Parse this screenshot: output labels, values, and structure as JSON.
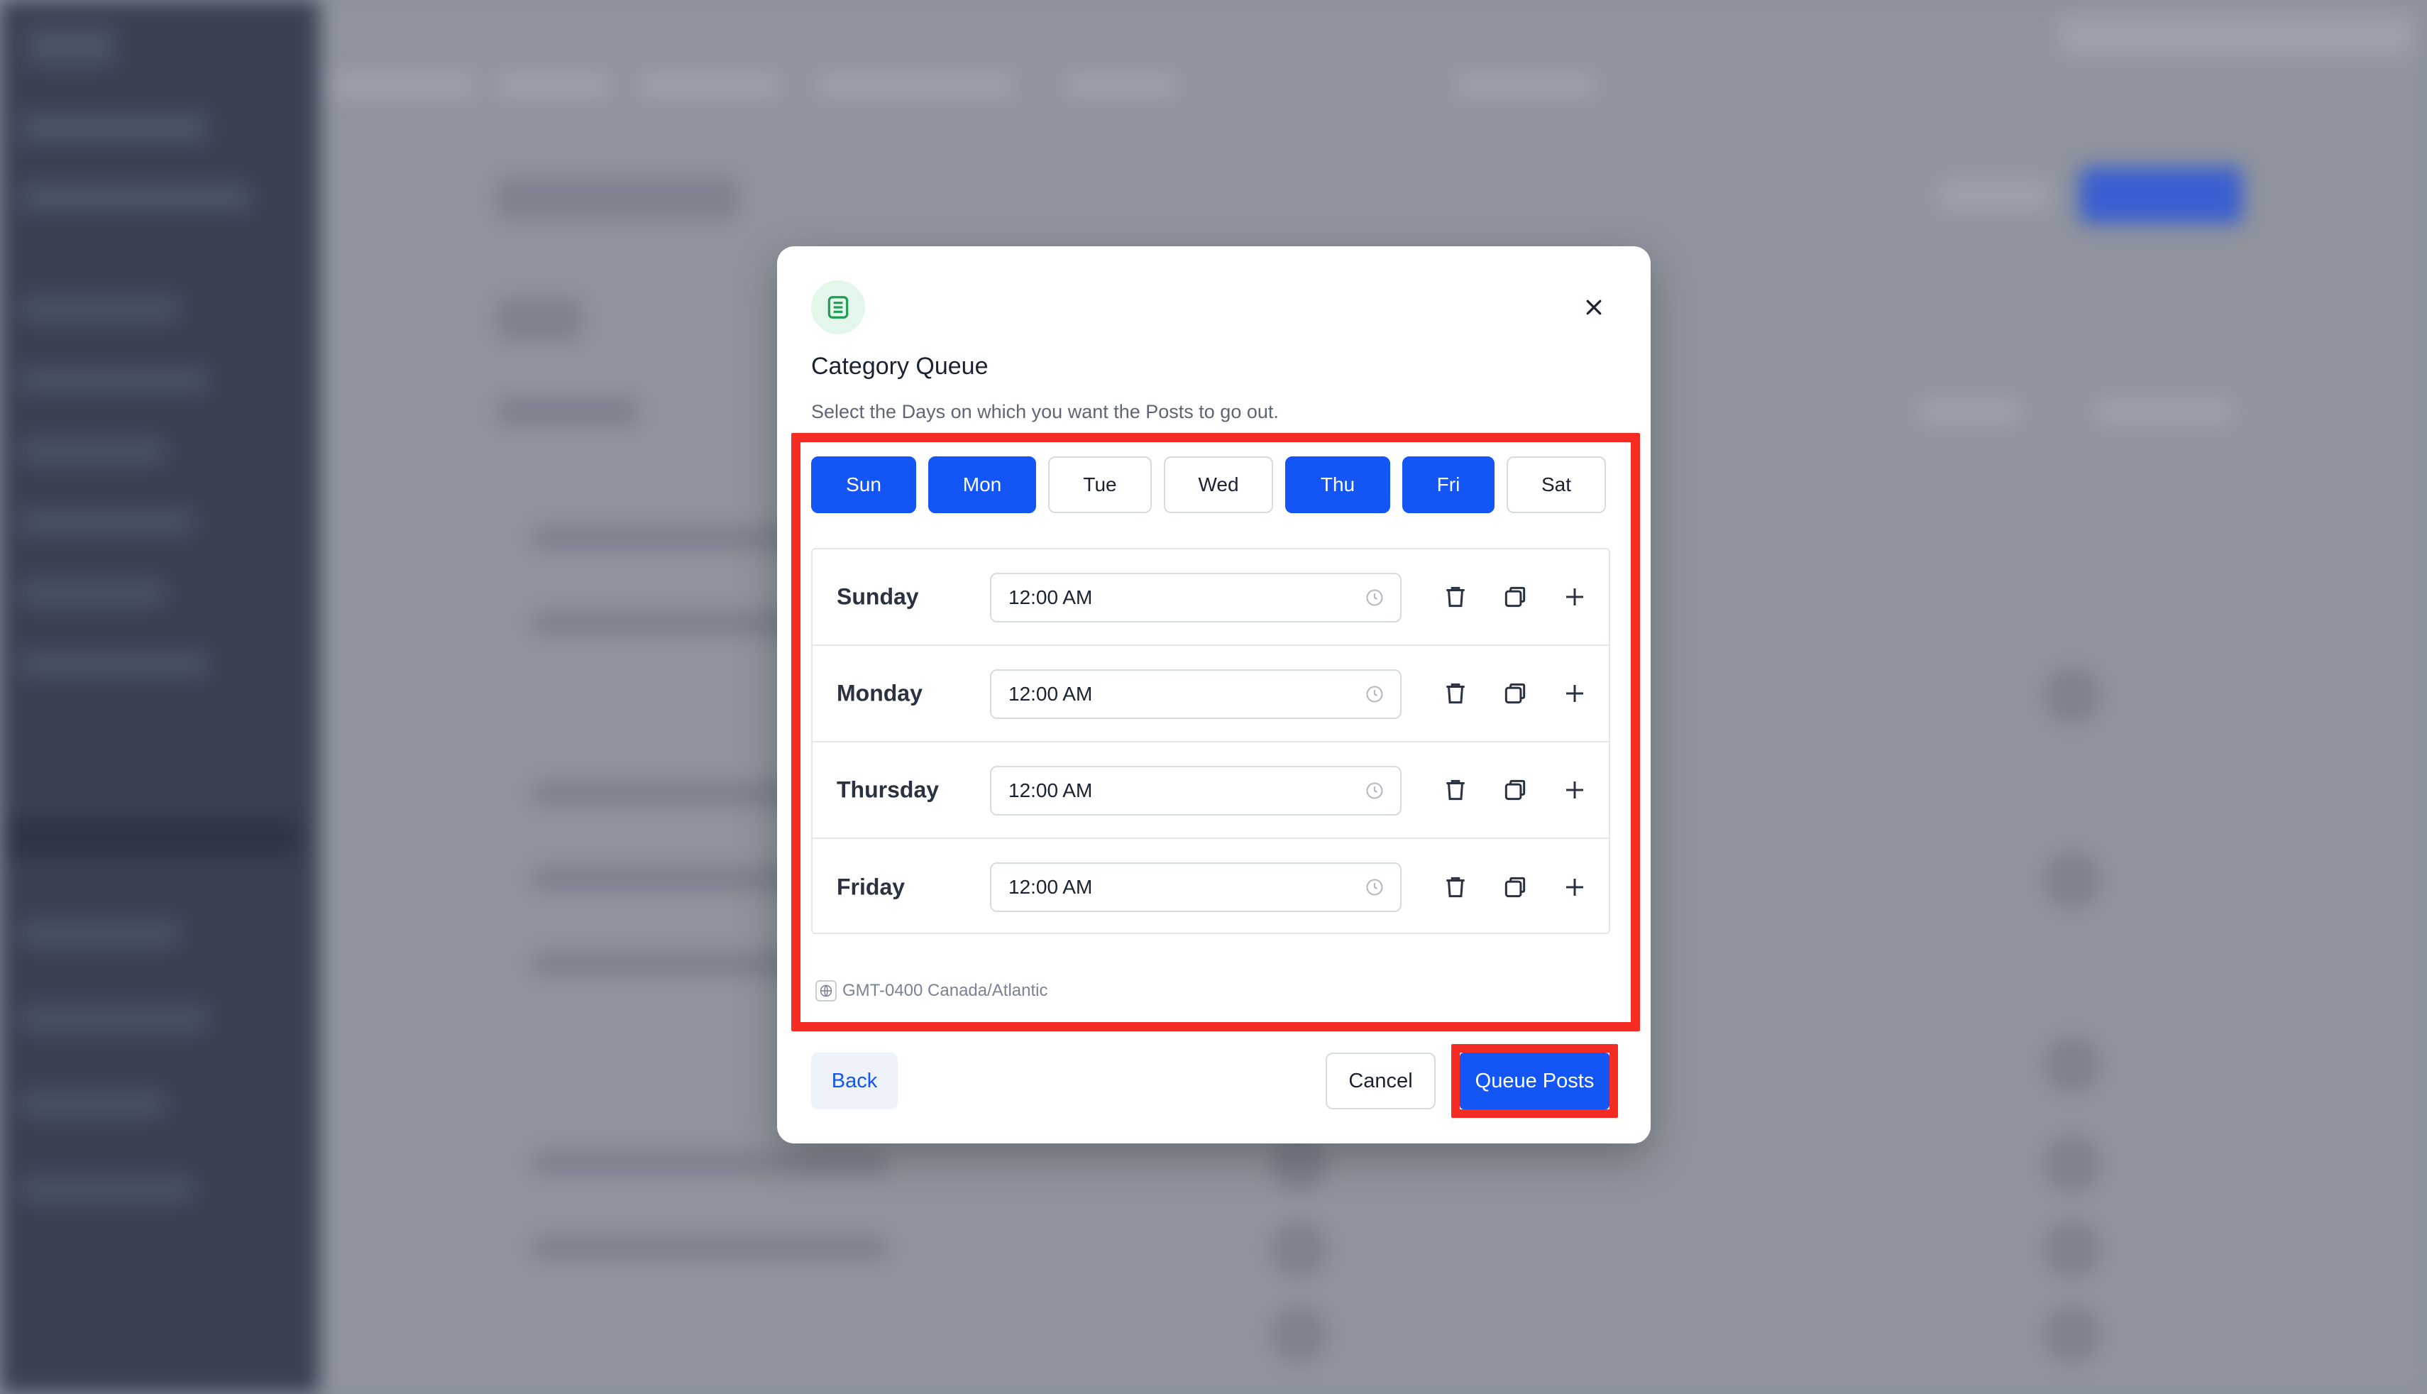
{
  "modal": {
    "title": "Category Queue",
    "subtitle": "Select the Days on which you want the Posts to go out.",
    "icon": "list-icon",
    "close_icon": "close-icon"
  },
  "days": [
    {
      "label": "Sun",
      "selected": true
    },
    {
      "label": "Mon",
      "selected": true
    },
    {
      "label": "Tue",
      "selected": false
    },
    {
      "label": "Wed",
      "selected": false
    },
    {
      "label": "Thu",
      "selected": true
    },
    {
      "label": "Fri",
      "selected": true
    },
    {
      "label": "Sat",
      "selected": false
    }
  ],
  "schedule": [
    {
      "day": "Sunday",
      "time": "12:00 AM"
    },
    {
      "day": "Monday",
      "time": "12:00 AM"
    },
    {
      "day": "Thursday",
      "time": "12:00 AM"
    },
    {
      "day": "Friday",
      "time": "12:00 AM"
    }
  ],
  "timezone": "GMT-0400 Canada/Atlantic",
  "footer": {
    "back_label": "Back",
    "cancel_label": "Cancel",
    "queue_label": "Queue Posts"
  },
  "colors": {
    "accent": "#1455f5",
    "highlight": "#f52c24",
    "icon_bg": "#e3f6ea",
    "icon_fg": "#1f9d55"
  }
}
